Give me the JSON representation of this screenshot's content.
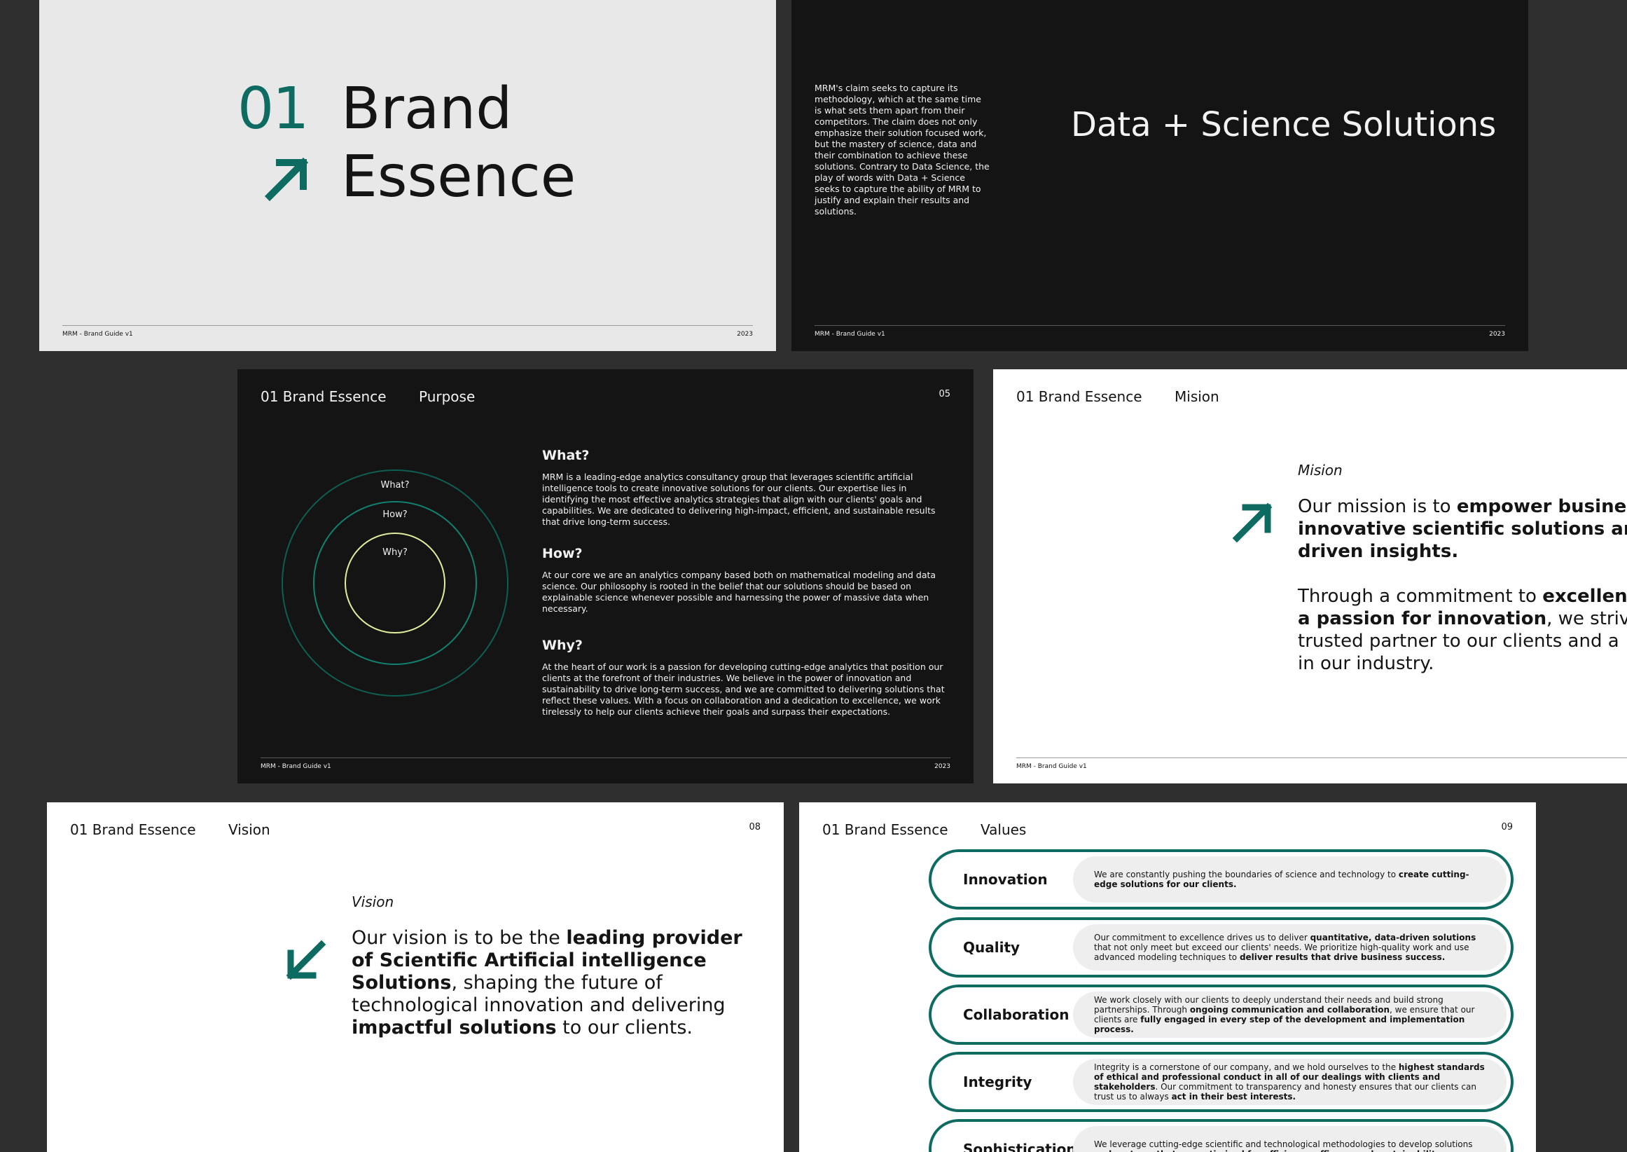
{
  "common": {
    "footer_left": "MRM - Brand Guide v1",
    "footer_year": "2023",
    "section": "01 Brand Essence",
    "brand_color": "#0e6b61"
  },
  "slide1": {
    "number": "01",
    "title_line1": "Brand",
    "title_line2": "Essence",
    "icon": "arrow-up-right-icon"
  },
  "slide2": {
    "paragraph": "MRM's claim seeks to capture its methodology, which at the same time is what sets them apart from their competitors. The claim does not only emphasize their solution focused work, but the mastery of science, data and their combination to achieve these solutions. Contrary to Data Science, the play of words with Data + Science seeks to capture the ability of MRM to justify and explain their results and solutions.",
    "headline": "Data + Science Solutions"
  },
  "slide3": {
    "subtitle": "Purpose",
    "page": "05",
    "circle_labels": [
      "What?",
      "How?",
      "Why?"
    ],
    "sections": [
      {
        "title": "What?",
        "text": "MRM is a leading-edge analytics consultancy group that leverages scientific artificial intelligence tools to create innovative solutions for our clients. Our expertise lies in identifying the most effective analytics strategies that align with our clients' goals and capabilities. We are dedicated to delivering high-impact, efficient, and sustainable results that drive long-term success."
      },
      {
        "title": "How?",
        "text": "At our core we are an analytics company based both on mathematical modeling and data science. Our philosophy is rooted in the belief that our solutions should be based on explainable science whenever possible and harnessing the power of massive data when necessary."
      },
      {
        "title": "Why?",
        "text": "At the heart of our work is a passion for developing cutting-edge analytics that position our clients at the forefront of their industries. We believe in the power of innovation and sustainability to drive long-term success, and we are committed to delivering solutions that reflect these values. With a focus on collaboration and a dedication to excellence, we work tirelessly to help our clients achieve their goals and surpass their expectations."
      }
    ]
  },
  "slide4": {
    "subtitle": "Mision",
    "label": "Mision",
    "icon": "arrow-up-right-icon",
    "p1": {
      "a": "Our mission is to ",
      "b": "empower businesse",
      "c": "innovative scientific solutions and d",
      "d": "driven insights."
    },
    "p2": {
      "a": "Through a commitment to ",
      "b": "excellenc",
      "c": "a passion for innovation",
      "d": ", we strive to",
      "e": "trusted partner to our clients and a",
      "f": "in our industry."
    }
  },
  "slide5": {
    "subtitle": "Vision",
    "page": "08",
    "label": "Vision",
    "icon": "arrow-down-left-icon",
    "t1": "Our vision is to be the ",
    "t2": "leading provider of Scientific Artificial intelligence Solutions",
    "t3": ", shaping the future of technological innovation and delivering ",
    "t4": "impactful solutions",
    "t5": " to our clients."
  },
  "slide6": {
    "subtitle": "Values",
    "page": "09",
    "values": [
      {
        "name": "Innovation",
        "parts": [
          {
            "t": "We are constantly pushing the boundaries of science and technology to "
          },
          {
            "t": "create cutting-edge solutions for our clients.",
            "b": true
          }
        ]
      },
      {
        "name": "Quality",
        "parts": [
          {
            "t": "Our commitment to excellence drives us to deliver "
          },
          {
            "t": "quantitative, data-driven solutions",
            "b": true
          },
          {
            "t": " that not only meet but exceed our clients' needs. We prioritize high-quality work and use advanced modeling techniques to "
          },
          {
            "t": "deliver results that drive business success.",
            "b": true
          }
        ]
      },
      {
        "name": "Collaboration",
        "parts": [
          {
            "t": "We work closely with our clients to deeply understand their needs and build strong partnerships. Through "
          },
          {
            "t": "ongoing communication and collaboration",
            "b": true
          },
          {
            "t": ", we ensure that our clients are "
          },
          {
            "t": "fully engaged in every step of the development and implementation process.",
            "b": true
          }
        ]
      },
      {
        "name": "Integrity",
        "parts": [
          {
            "t": "Integrity is a cornerstone of our company, and we hold ourselves to the "
          },
          {
            "t": "highest standards of ethical and professional conduct in all of our dealings with clients and stakeholders",
            "b": true
          },
          {
            "t": ". Our commitment to transparency and honesty ensures that our clients can trust us to always "
          },
          {
            "t": "act in their best interests.",
            "b": true
          }
        ]
      },
      {
        "name": "Sophistication",
        "parts": [
          {
            "t": "We leverage cutting-edge scientific and technological methodologies to develop solutions "
          },
          {
            "t": "and systems that are optimized for efficiency, efficacy, and sustainability.",
            "b": true
          }
        ]
      }
    ]
  }
}
